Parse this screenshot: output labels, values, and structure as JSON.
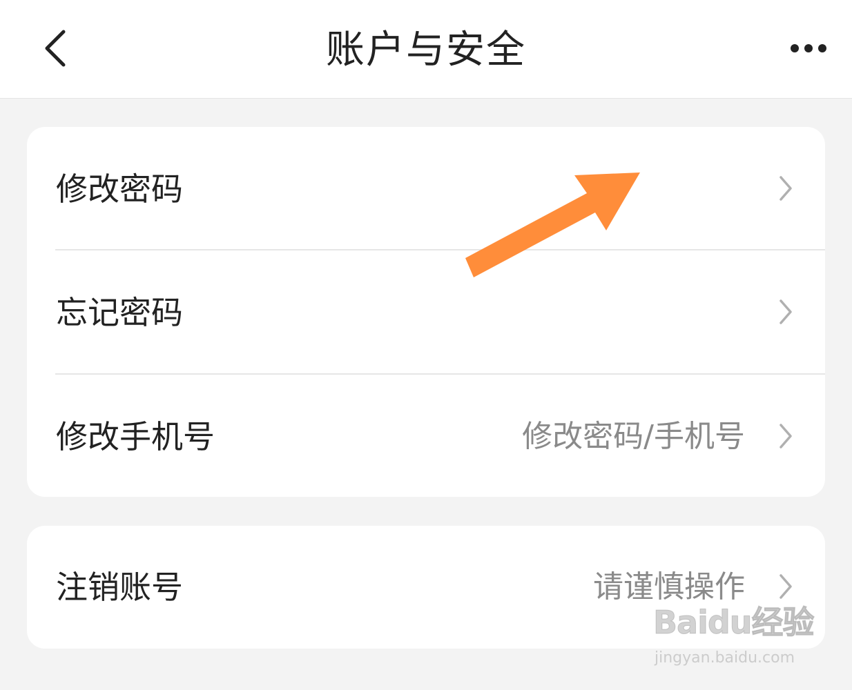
{
  "header": {
    "title": "账户与安全",
    "back_icon": "chevron-left-icon",
    "more_icon": "more-horizontal-icon"
  },
  "groups": [
    {
      "items": [
        {
          "label": "修改密码",
          "hint": "",
          "icon": "chevron-right-icon"
        },
        {
          "label": "忘记密码",
          "hint": "",
          "icon": "chevron-right-icon"
        },
        {
          "label": "修改手机号",
          "hint": "修改密码/手机号",
          "icon": "chevron-right-icon"
        }
      ]
    },
    {
      "items": [
        {
          "label": "注销账号",
          "hint": "请谨慎操作",
          "icon": "chevron-right-icon"
        }
      ]
    }
  ],
  "annotation": {
    "arrow_color": "#ff8d3a"
  },
  "watermark": {
    "logo": "Baidu经验",
    "url": "jingyan.baidu.com"
  },
  "colors": {
    "background": "#f3f3f3",
    "card": "#ffffff",
    "hint_text": "#8a8a8a"
  }
}
